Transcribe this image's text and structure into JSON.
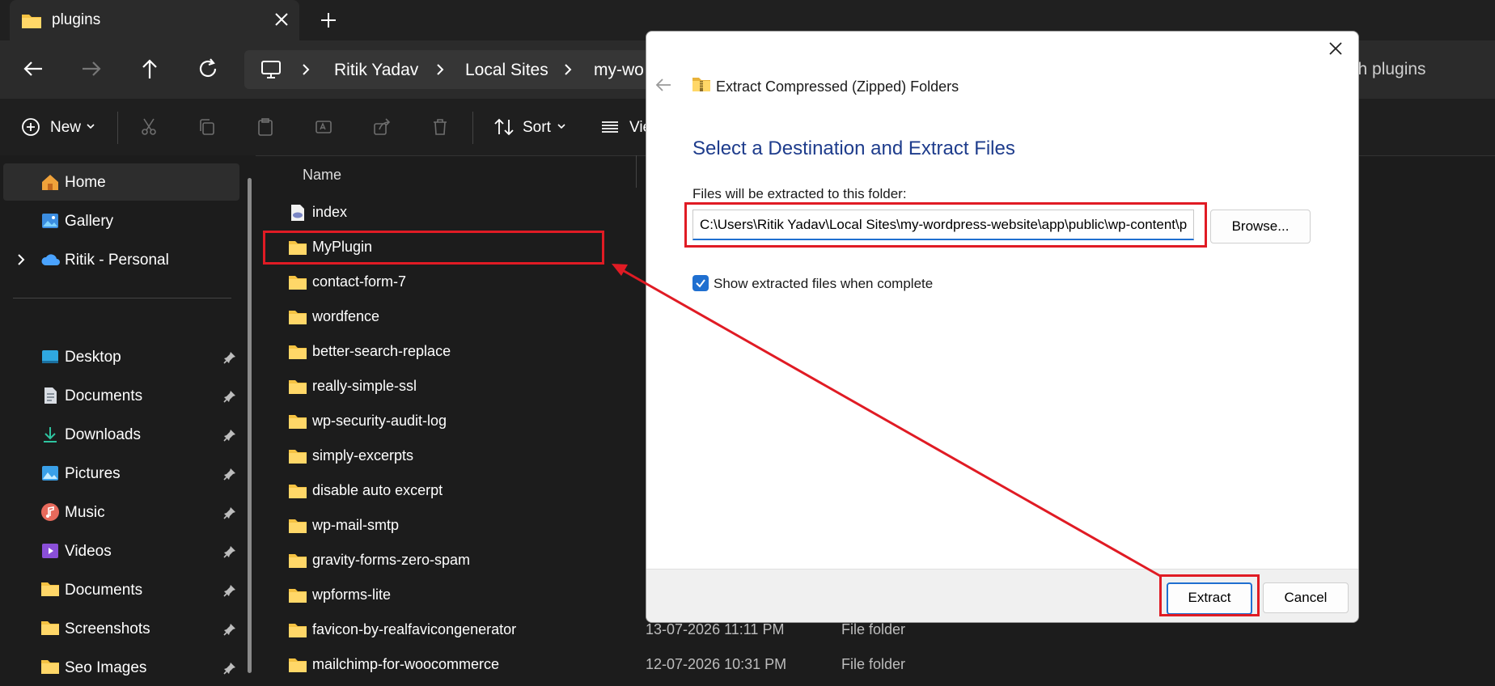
{
  "window": {
    "tab_title": "plugins"
  },
  "address": {
    "breadcrumbs": [
      "Ritik Yadav",
      "Local Sites",
      "my-wo"
    ],
    "search_placeholder": "ch plugins"
  },
  "toolbar": {
    "new_label": "New",
    "sort_label": "Sort",
    "view_label": "Vie"
  },
  "sidebar": {
    "top_items": [
      {
        "label": "Home",
        "icon": "home-icon"
      },
      {
        "label": "Gallery",
        "icon": "gallery-icon"
      },
      {
        "label": "Ritik - Personal",
        "icon": "cloud-icon"
      }
    ],
    "pinned_items": [
      {
        "label": "Desktop",
        "icon": "desktop-icon"
      },
      {
        "label": "Documents",
        "icon": "document-icon"
      },
      {
        "label": "Downloads",
        "icon": "download-icon"
      },
      {
        "label": "Pictures",
        "icon": "pictures-icon"
      },
      {
        "label": "Music",
        "icon": "music-icon"
      },
      {
        "label": "Videos",
        "icon": "video-icon"
      },
      {
        "label": "Documents",
        "icon": "folder-icon"
      },
      {
        "label": "Screenshots",
        "icon": "folder-icon"
      },
      {
        "label": "Seo Images",
        "icon": "folder-icon"
      }
    ]
  },
  "files": {
    "column_name": "Name",
    "rows": [
      {
        "name": "index",
        "date": "",
        "type": ""
      },
      {
        "name": "MyPlugin",
        "date": "",
        "type": ""
      },
      {
        "name": "contact-form-7",
        "date": "",
        "type": ""
      },
      {
        "name": "wordfence",
        "date": "",
        "type": ""
      },
      {
        "name": "better-search-replace",
        "date": "",
        "type": ""
      },
      {
        "name": "really-simple-ssl",
        "date": "",
        "type": ""
      },
      {
        "name": "wp-security-audit-log",
        "date": "",
        "type": ""
      },
      {
        "name": "simply-excerpts",
        "date": "",
        "type": ""
      },
      {
        "name": "disable auto excerpt",
        "date": "",
        "type": ""
      },
      {
        "name": "wp-mail-smtp",
        "date": "",
        "type": ""
      },
      {
        "name": "gravity-forms-zero-spam",
        "date": "",
        "type": ""
      },
      {
        "name": "wpforms-lite",
        "date": "",
        "type": ""
      },
      {
        "name": "favicon-by-realfavicongenerator",
        "date": "13-07-2026 11:11 PM",
        "type": "File folder"
      },
      {
        "name": "mailchimp-for-woocommerce",
        "date": "12-07-2026 10:31 PM",
        "type": "File folder"
      }
    ]
  },
  "dialog": {
    "title": "Extract Compressed (Zipped) Folders",
    "heading": "Select a Destination and Extract Files",
    "label": "Files will be extracted to this folder:",
    "path_value": "C:\\Users\\Ritik Yadav\\Local Sites\\my-wordpress-website\\app\\public\\wp-content\\plugins",
    "browse_label": "Browse...",
    "checkbox_label": "Show extracted files when complete",
    "checkbox_checked": true,
    "extract_label": "Extract",
    "cancel_label": "Cancel"
  },
  "colors": {
    "highlight": "#e01b24",
    "accent": "#1f6fd0",
    "folder": "#f5c242"
  }
}
